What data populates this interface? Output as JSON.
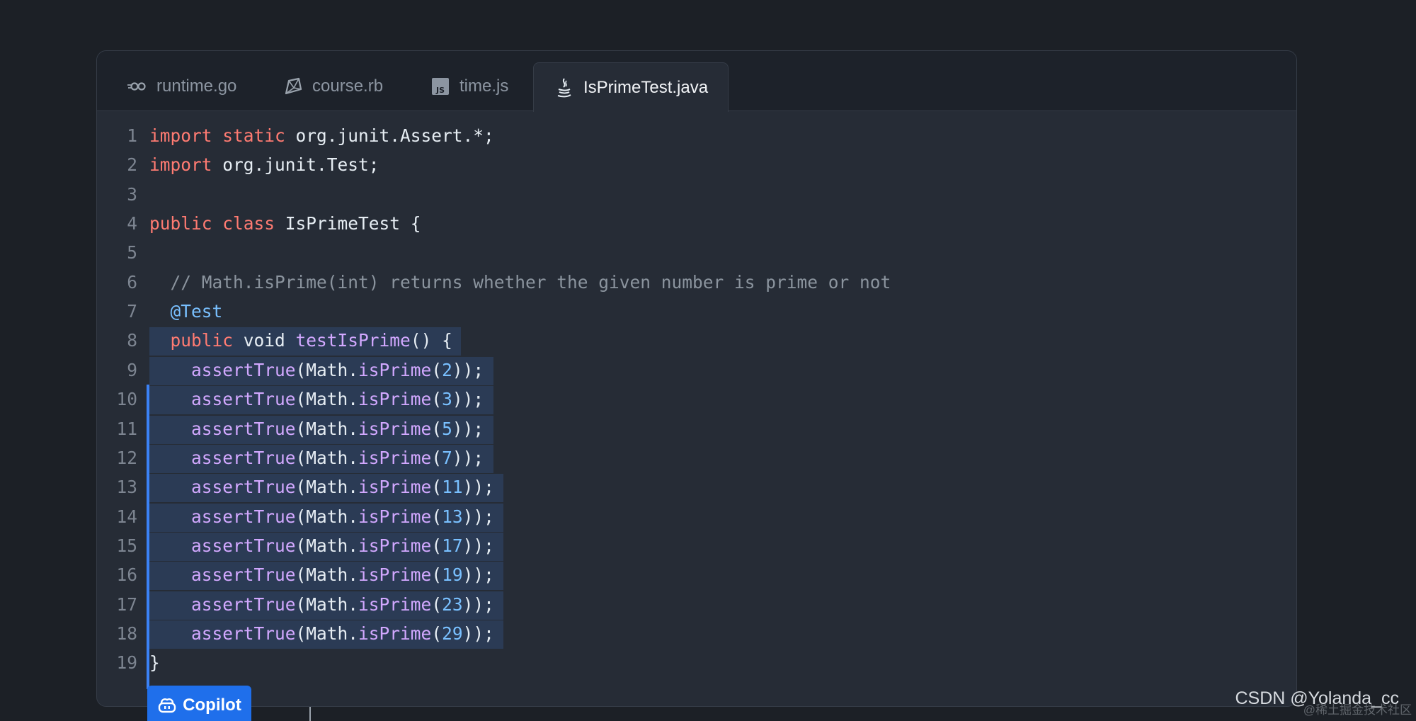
{
  "tabs": [
    {
      "label": "runtime.go",
      "icon": "go-icon",
      "active": false
    },
    {
      "label": "course.rb",
      "icon": "ruby-icon",
      "active": false
    },
    {
      "label": "time.js",
      "icon": "javascript-icon",
      "active": false
    },
    {
      "label": "IsPrimeTest.java",
      "icon": "java-icon",
      "active": true
    }
  ],
  "code": {
    "line_numbers": [
      "1",
      "2",
      "3",
      "4",
      "5",
      "6",
      "7",
      "8",
      "9",
      "10",
      "11",
      "12",
      "13",
      "14",
      "15",
      "16",
      "17",
      "18",
      "19"
    ],
    "lines": [
      [
        {
          "t": "import",
          "k": "kw"
        },
        {
          "t": " "
        },
        {
          "t": "static",
          "k": "kw"
        },
        {
          "t": " org.junit.Assert.*;"
        }
      ],
      [
        {
          "t": "import",
          "k": "kw"
        },
        {
          "t": " org.junit.Test;"
        }
      ],
      [],
      [
        {
          "t": "public",
          "k": "kw"
        },
        {
          "t": " "
        },
        {
          "t": "class",
          "k": "kw"
        },
        {
          "t": " IsPrimeTest {"
        }
      ],
      [],
      [
        {
          "t": "  // Math.isPrime(int) returns whether the given number is prime or not",
          "k": "cm"
        }
      ],
      [
        {
          "t": "  "
        },
        {
          "t": "@Test",
          "k": "ann"
        }
      ],
      [
        {
          "t": "  "
        },
        {
          "t": "public",
          "k": "kw"
        },
        {
          "t": " void "
        },
        {
          "t": "testIsPrime",
          "k": "fn"
        },
        {
          "t": "() {"
        }
      ],
      [
        {
          "t": "    "
        },
        {
          "t": "assertTrue",
          "k": "fn"
        },
        {
          "t": "(Math."
        },
        {
          "t": "isPrime",
          "k": "fn"
        },
        {
          "t": "("
        },
        {
          "t": "2",
          "k": "num"
        },
        {
          "t": "));"
        }
      ],
      [
        {
          "t": "    "
        },
        {
          "t": "assertTrue",
          "k": "fn"
        },
        {
          "t": "(Math."
        },
        {
          "t": "isPrime",
          "k": "fn"
        },
        {
          "t": "("
        },
        {
          "t": "3",
          "k": "num"
        },
        {
          "t": "));"
        }
      ],
      [
        {
          "t": "    "
        },
        {
          "t": "assertTrue",
          "k": "fn"
        },
        {
          "t": "(Math."
        },
        {
          "t": "isPrime",
          "k": "fn"
        },
        {
          "t": "("
        },
        {
          "t": "5",
          "k": "num"
        },
        {
          "t": "));"
        }
      ],
      [
        {
          "t": "    "
        },
        {
          "t": "assertTrue",
          "k": "fn"
        },
        {
          "t": "(Math."
        },
        {
          "t": "isPrime",
          "k": "fn"
        },
        {
          "t": "("
        },
        {
          "t": "7",
          "k": "num"
        },
        {
          "t": "));"
        }
      ],
      [
        {
          "t": "    "
        },
        {
          "t": "assertTrue",
          "k": "fn"
        },
        {
          "t": "(Math."
        },
        {
          "t": "isPrime",
          "k": "fn"
        },
        {
          "t": "("
        },
        {
          "t": "11",
          "k": "num"
        },
        {
          "t": "));"
        }
      ],
      [
        {
          "t": "    "
        },
        {
          "t": "assertTrue",
          "k": "fn"
        },
        {
          "t": "(Math."
        },
        {
          "t": "isPrime",
          "k": "fn"
        },
        {
          "t": "("
        },
        {
          "t": "13",
          "k": "num"
        },
        {
          "t": "));"
        }
      ],
      [
        {
          "t": "    "
        },
        {
          "t": "assertTrue",
          "k": "fn"
        },
        {
          "t": "(Math."
        },
        {
          "t": "isPrime",
          "k": "fn"
        },
        {
          "t": "("
        },
        {
          "t": "17",
          "k": "num"
        },
        {
          "t": "));"
        }
      ],
      [
        {
          "t": "    "
        },
        {
          "t": "assertTrue",
          "k": "fn"
        },
        {
          "t": "(Math."
        },
        {
          "t": "isPrime",
          "k": "fn"
        },
        {
          "t": "("
        },
        {
          "t": "19",
          "k": "num"
        },
        {
          "t": "));"
        }
      ],
      [
        {
          "t": "    "
        },
        {
          "t": "assertTrue",
          "k": "fn"
        },
        {
          "t": "(Math."
        },
        {
          "t": "isPrime",
          "k": "fn"
        },
        {
          "t": "("
        },
        {
          "t": "23",
          "k": "num"
        },
        {
          "t": "));"
        }
      ],
      [
        {
          "t": "    "
        },
        {
          "t": "assertTrue",
          "k": "fn"
        },
        {
          "t": "(Math."
        },
        {
          "t": "isPrime",
          "k": "fn"
        },
        {
          "t": "("
        },
        {
          "t": "29",
          "k": "num"
        },
        {
          "t": "));"
        }
      ],
      [
        {
          "t": "}"
        }
      ]
    ]
  },
  "copilot": {
    "label": "Copilot",
    "icon": "copilot-icon"
  },
  "watermark": {
    "main": "CSDN @Yolanda_cc",
    "faint": "@稀土掘金技术社区"
  },
  "colors": {
    "background": "#1c2026",
    "editor": "#262c36",
    "keyword": "#ff7b72",
    "function": "#d2a8ff",
    "number": "#79c0ff",
    "comment": "#8b949e",
    "selection": "#2b3b55",
    "accent": "#1f6feb"
  }
}
